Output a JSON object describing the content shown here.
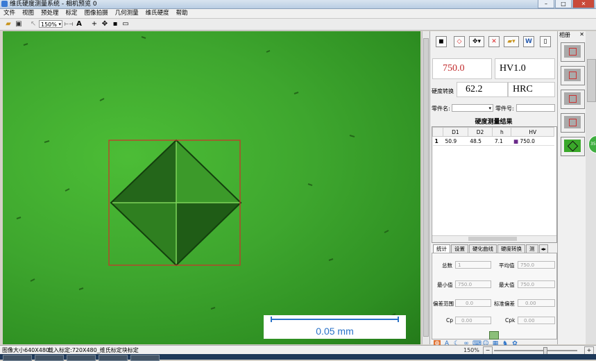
{
  "window": {
    "title": "维氏硬度测量系统 - 相机预览 0"
  },
  "menu": [
    "文件",
    "视图",
    "预处理",
    "标定",
    "图像拍摄",
    "几何测量",
    "维氏硬度",
    "帮助"
  ],
  "toolbar": {
    "zoom_value": "150%"
  },
  "image": {
    "scale_label": "0.05 mm"
  },
  "results": {
    "hv_value": "750.0",
    "hv_unit": "HV1.0",
    "convert_label": "硬度转换",
    "convert_value": "62.2",
    "convert_unit": "HRC",
    "part_name_label": "零件名:",
    "part_no_label": "零件号:",
    "table_title": "硬度测量结果",
    "columns": [
      "",
      "D1",
      "D2",
      "h",
      "HV"
    ],
    "rows": [
      {
        "idx": "1",
        "d1": "50.9",
        "d2": "48.5",
        "h": "7.1",
        "hv": "750.0"
      }
    ]
  },
  "tabs": [
    "统计",
    "设置",
    "硬化曲线",
    "硬度转换",
    "测"
  ],
  "stats": {
    "count_label": "总数",
    "count_value": "1",
    "avg_label": "平均值",
    "avg_value": "750.0",
    "min_label": "最小值",
    "min_value": "750.0",
    "max_label": "最大值",
    "max_value": "750.0",
    "range_label": "偏差范围",
    "range_value": "0.0",
    "std_label": "标准偏差",
    "std_value": "0.00",
    "cp_label": "Cp",
    "cp_value": "0.00",
    "cpk_label": "Cpk",
    "cpk_value": "0.00"
  },
  "gallery": {
    "title": "相册"
  },
  "status": {
    "image_size": "图像大小640X480",
    "calibration": "载入标定:720X480_维氏标定块标定",
    "zoom": "150%"
  }
}
